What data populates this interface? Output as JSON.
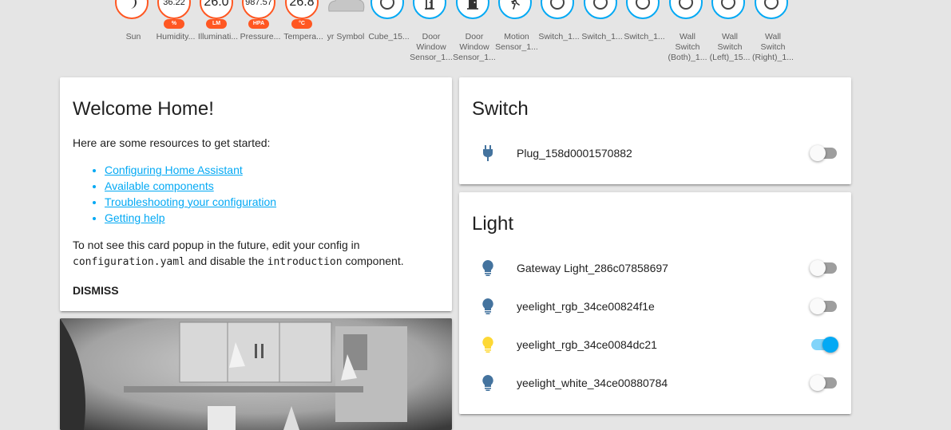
{
  "colors": {
    "accent": "#03a9f4",
    "sensor_border": "#ff5722",
    "icon_off": "#44739e",
    "icon_on": "#fdd835"
  },
  "badges": [
    {
      "label": "Sun",
      "icon": "moon-icon"
    },
    {
      "value": "36.22",
      "unit": "%",
      "label": "Humidity..."
    },
    {
      "value": "26.0",
      "unit": "LM",
      "label": "Illuminati..."
    },
    {
      "value": "987.57",
      "unit": "HPA",
      "label": "Pressure..."
    },
    {
      "value": "26.8",
      "unit": "°C",
      "label": "Tempera..."
    },
    {
      "label": "yr Symbol",
      "icon": "cloud-icon"
    },
    {
      "label": "Cube_15...",
      "icon": "circle-icon"
    },
    {
      "label": "Door\nWindow\nSensor_1...",
      "icon": "door-open-icon"
    },
    {
      "label": "Door\nWindow\nSensor_1...",
      "icon": "door-closed-icon"
    },
    {
      "label": "Motion\nSensor_1...",
      "icon": "walk-icon"
    },
    {
      "label": "Switch_1...",
      "icon": "circle-icon"
    },
    {
      "label": "Switch_1...",
      "icon": "circle-icon"
    },
    {
      "label": "Switch_1...",
      "icon": "circle-icon"
    },
    {
      "label": "Wall\nSwitch\n(Both)_1...",
      "icon": "circle-icon"
    },
    {
      "label": "Wall\nSwitch\n(Left)_15...",
      "icon": "circle-icon"
    },
    {
      "label": "Wall\nSwitch\n(Right)_1...",
      "icon": "circle-icon"
    }
  ],
  "welcome": {
    "title": "Welcome Home!",
    "intro": "Here are some resources to get started:",
    "links": [
      "Configuring Home Assistant",
      "Available components",
      "Troubleshooting your configuration",
      "Getting help"
    ],
    "note_part1": "To not see this card popup in the future, edit your config in",
    "note_code1": "configuration.yaml",
    "note_part2": " and disable the ",
    "note_code2": "introduction",
    "note_part3": " component.",
    "dismiss": "DISMISS"
  },
  "switch_card": {
    "title": "Switch",
    "items": [
      {
        "name": "Plug_158d0001570882",
        "icon": "power-plug-icon",
        "on": false
      }
    ]
  },
  "light_card": {
    "title": "Light",
    "items": [
      {
        "name": "Gateway Light_286c07858697",
        "icon": "lightbulb-icon",
        "on": false
      },
      {
        "name": "yeelight_rgb_34ce00824f1e",
        "icon": "lightbulb-icon",
        "on": false
      },
      {
        "name": "yeelight_rgb_34ce0084dc21",
        "icon": "lightbulb-icon",
        "on": true
      },
      {
        "name": "yeelight_white_34ce00880784",
        "icon": "lightbulb-icon",
        "on": false
      }
    ]
  }
}
